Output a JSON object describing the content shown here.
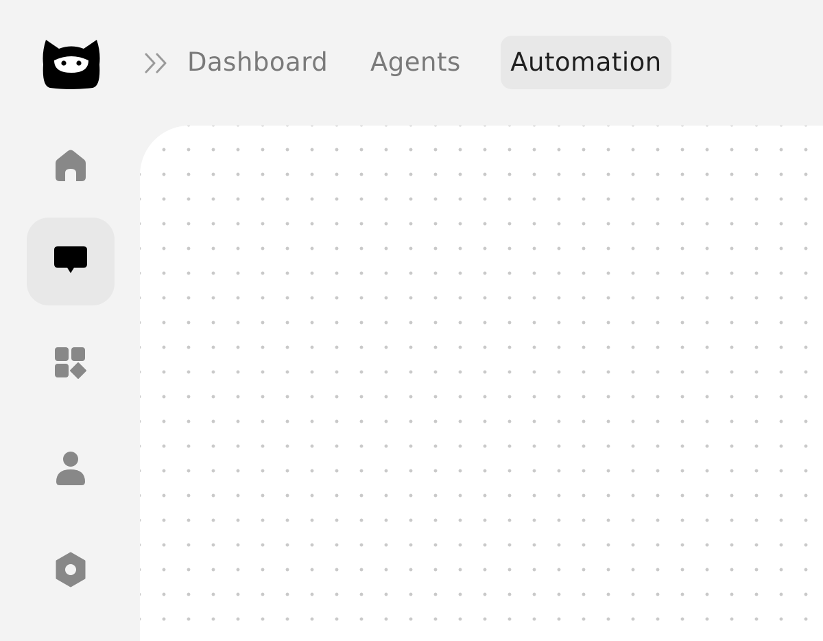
{
  "app": {
    "logo_icon": "ninja-mask-logo-icon"
  },
  "nav": {
    "expand_icon": "chevrons-right-icon",
    "tabs": [
      {
        "label": "Dashboard",
        "active": false
      },
      {
        "label": "Agents",
        "active": false
      },
      {
        "label": "Automation",
        "active": true
      }
    ]
  },
  "sidebar": {
    "items": [
      {
        "icon": "home-icon",
        "active": false
      },
      {
        "icon": "chat-bubble-icon",
        "active": true
      },
      {
        "icon": "apps-grid-icon",
        "active": false
      },
      {
        "icon": "user-icon",
        "active": false
      },
      {
        "icon": "settings-hex-icon",
        "active": false
      }
    ]
  },
  "colors": {
    "page_background": "#f3f3f3",
    "canvas_background": "#ffffff",
    "canvas_dot": "#c9c9c9",
    "active_tab_background": "#e8e8e8",
    "active_text": "#1f1f1f",
    "inactive_text": "#7a7a7a",
    "inactive_icon": "#888888",
    "active_icon": "#000000"
  }
}
